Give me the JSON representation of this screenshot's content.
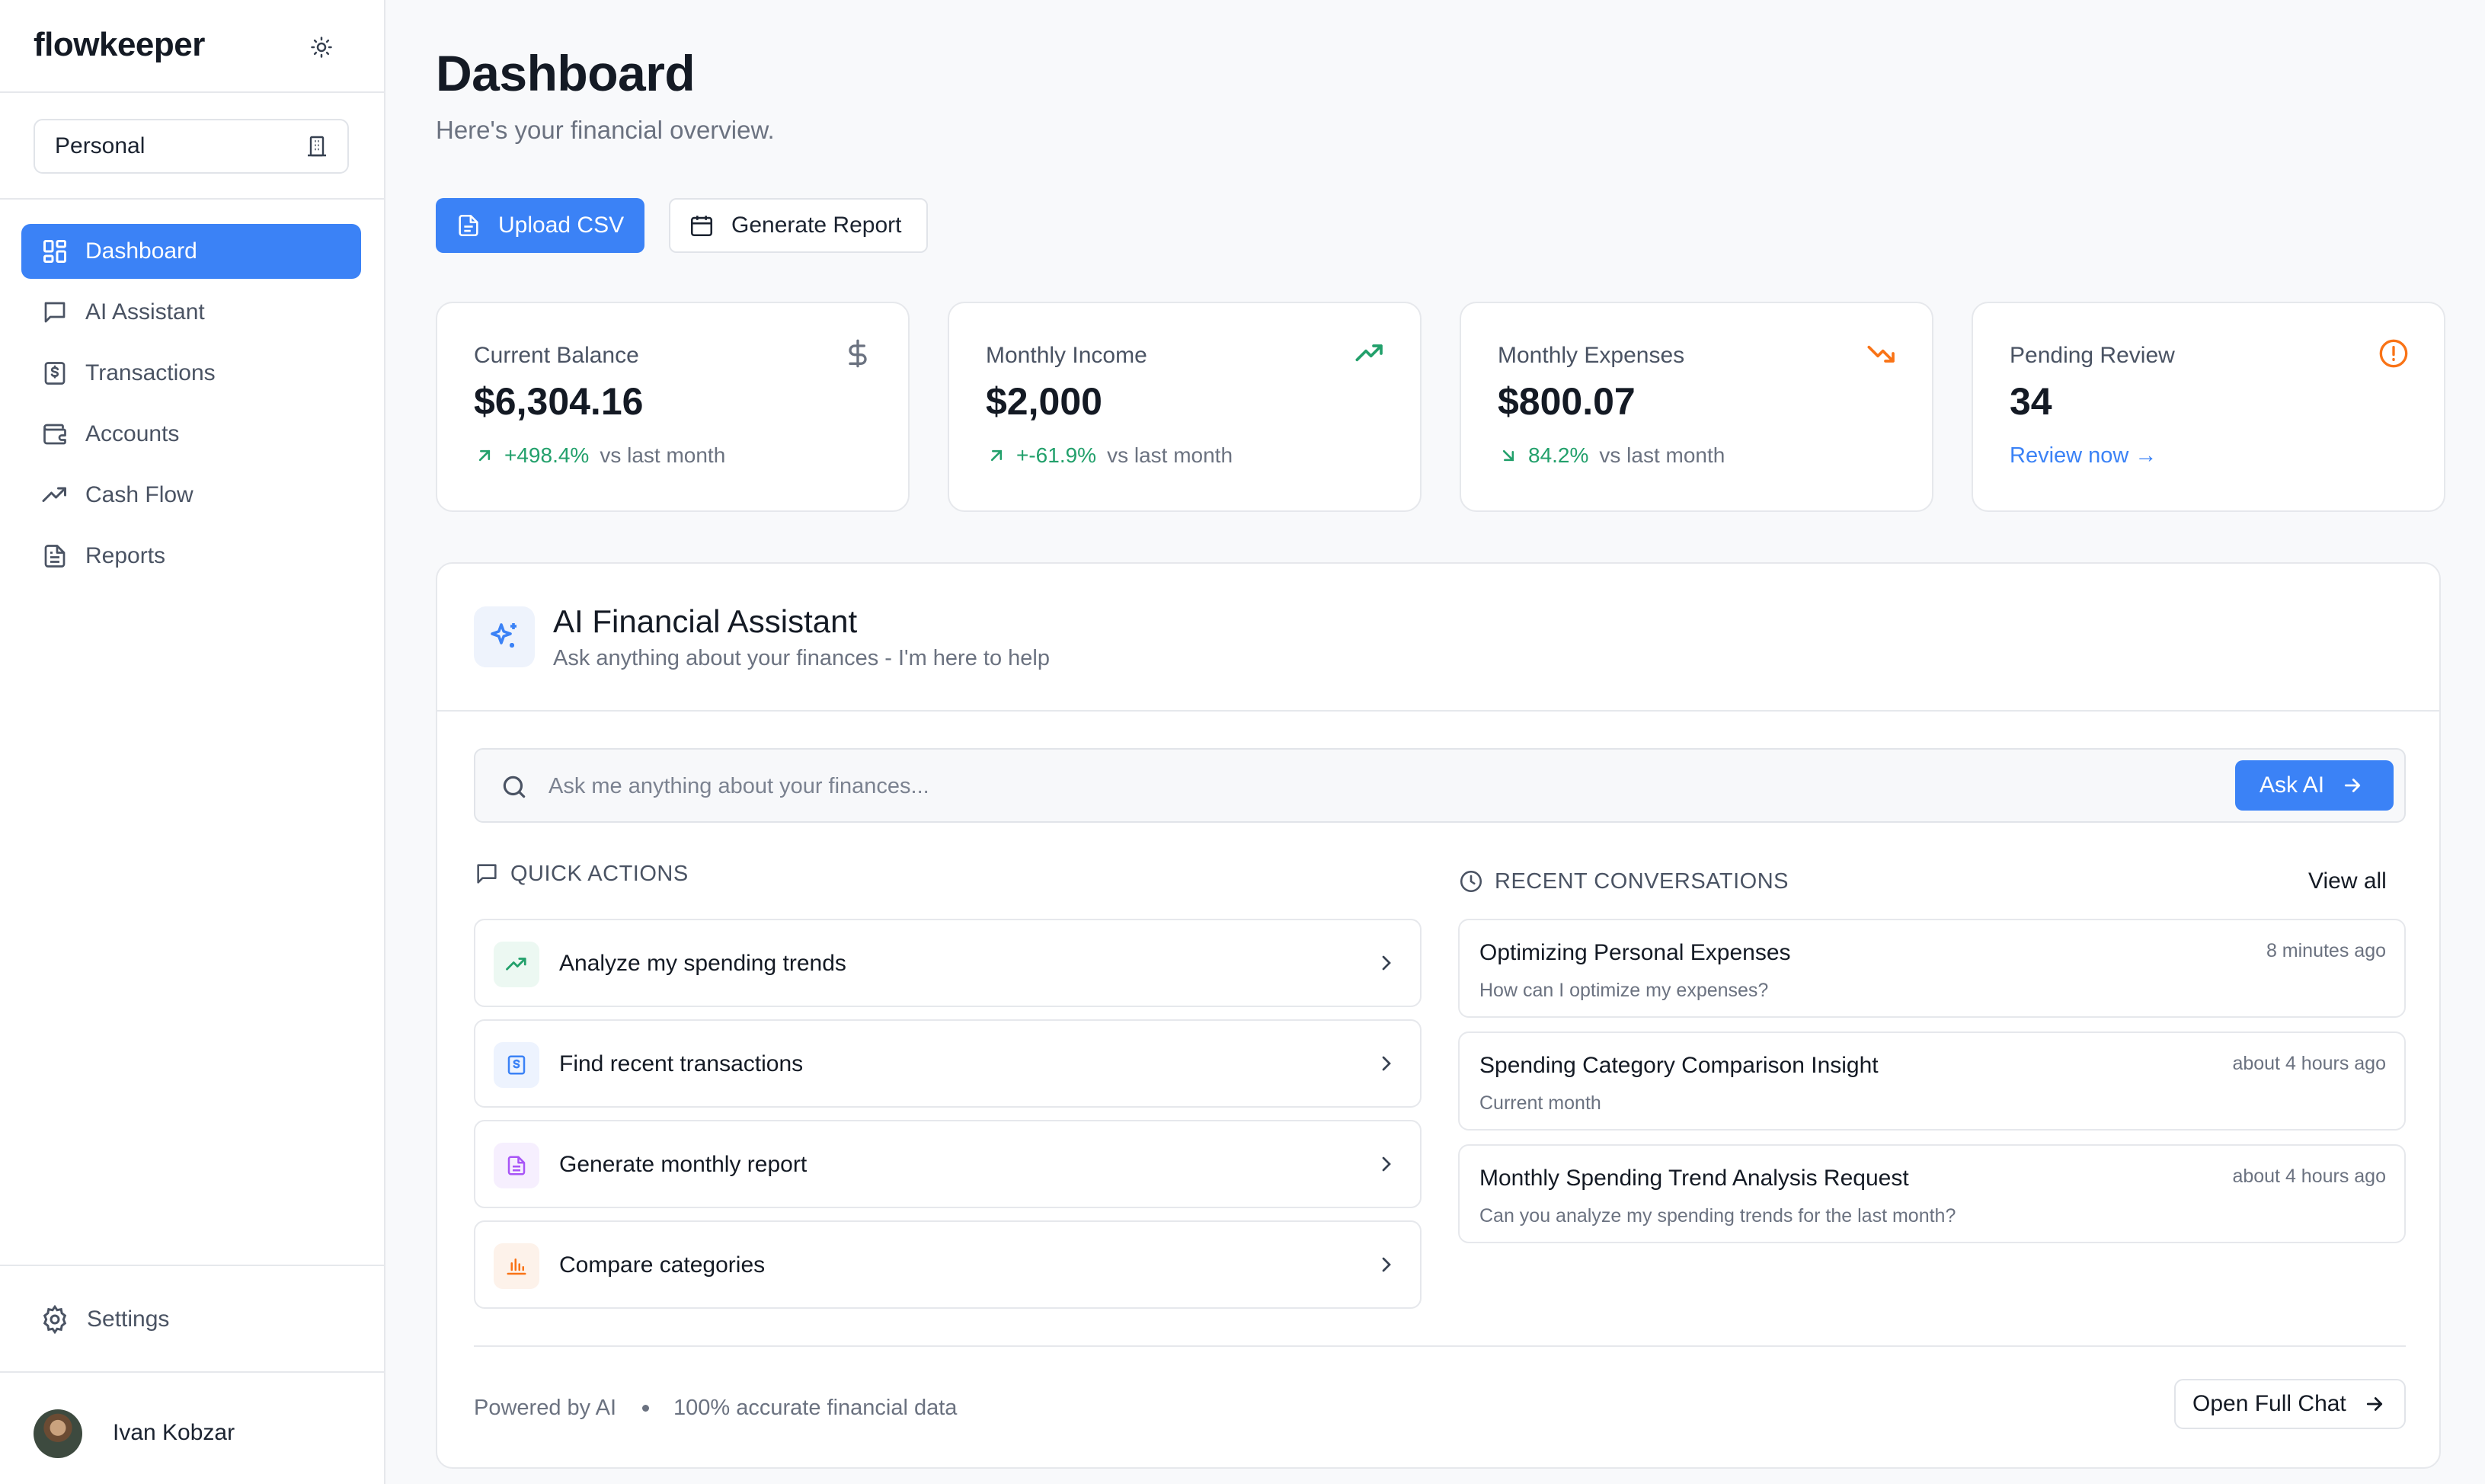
{
  "app": {
    "brand": "flowkeeper"
  },
  "workspace": {
    "selected": "Personal"
  },
  "sidebar": {
    "items": [
      {
        "label": "Dashboard",
        "icon": "dashboard-grid-icon",
        "active": true
      },
      {
        "label": "AI Assistant",
        "icon": "chat-bubble-icon",
        "active": false
      },
      {
        "label": "Transactions",
        "icon": "receipt-dollar-icon",
        "active": false
      },
      {
        "label": "Accounts",
        "icon": "wallet-icon",
        "active": false
      },
      {
        "label": "Cash Flow",
        "icon": "trend-up-icon",
        "active": false
      },
      {
        "label": "Reports",
        "icon": "document-icon",
        "active": false
      }
    ],
    "settings_label": "Settings",
    "user_name": "Ivan Kobzar"
  },
  "header": {
    "title": "Dashboard",
    "subtitle": "Here's your financial overview."
  },
  "actions": {
    "upload_label": "Upload CSV",
    "report_label": "Generate Report"
  },
  "stats": {
    "balance": {
      "label": "Current Balance",
      "value": "$6,304.16",
      "change": "+498.4%",
      "vs": "vs last month"
    },
    "income": {
      "label": "Monthly Income",
      "value": "$2,000",
      "change": "+-61.9%",
      "vs": "vs last month"
    },
    "expenses": {
      "label": "Monthly Expenses",
      "value": "$800.07",
      "change": "84.2%",
      "vs": "vs last month"
    },
    "pending": {
      "label": "Pending Review",
      "value": "34",
      "link": "Review now →"
    }
  },
  "assistant": {
    "title": "AI Financial Assistant",
    "subtitle": "Ask anything about your finances - I'm here to help",
    "input_placeholder": "Ask me anything about your finances...",
    "ask_label": "Ask AI",
    "quick_actions_label": "QUICK ACTIONS",
    "quick_actions": [
      {
        "label": "Analyze my spending trends",
        "icon": "trend-up-icon",
        "color": "#22a06b"
      },
      {
        "label": "Find recent transactions",
        "icon": "receipt-icon",
        "color": "#3b82f6"
      },
      {
        "label": "Generate monthly report",
        "icon": "document-icon",
        "color": "#a855f7"
      },
      {
        "label": "Compare categories",
        "icon": "bar-chart-icon",
        "color": "#f97316"
      }
    ],
    "recent_label": "RECENT CONVERSATIONS",
    "view_all_label": "View all",
    "conversations": [
      {
        "title": "Optimizing Personal Expenses",
        "subtitle": "How can I optimize my expenses?",
        "time": "8 minutes ago"
      },
      {
        "title": "Spending Category Comparison Insight",
        "subtitle": "Current month",
        "time": "about 4 hours ago"
      },
      {
        "title": "Monthly Spending Trend Analysis Request",
        "subtitle": "Can you analyze my spending trends for the last month?",
        "time": "about 4 hours ago"
      }
    ],
    "powered_by": "Powered by AI",
    "accuracy_note": "100% accurate financial data",
    "open_chat_label": "Open Full Chat"
  },
  "colors": {
    "accent": "#3b82f6",
    "positive": "#22a06b",
    "warning": "#f97316"
  }
}
